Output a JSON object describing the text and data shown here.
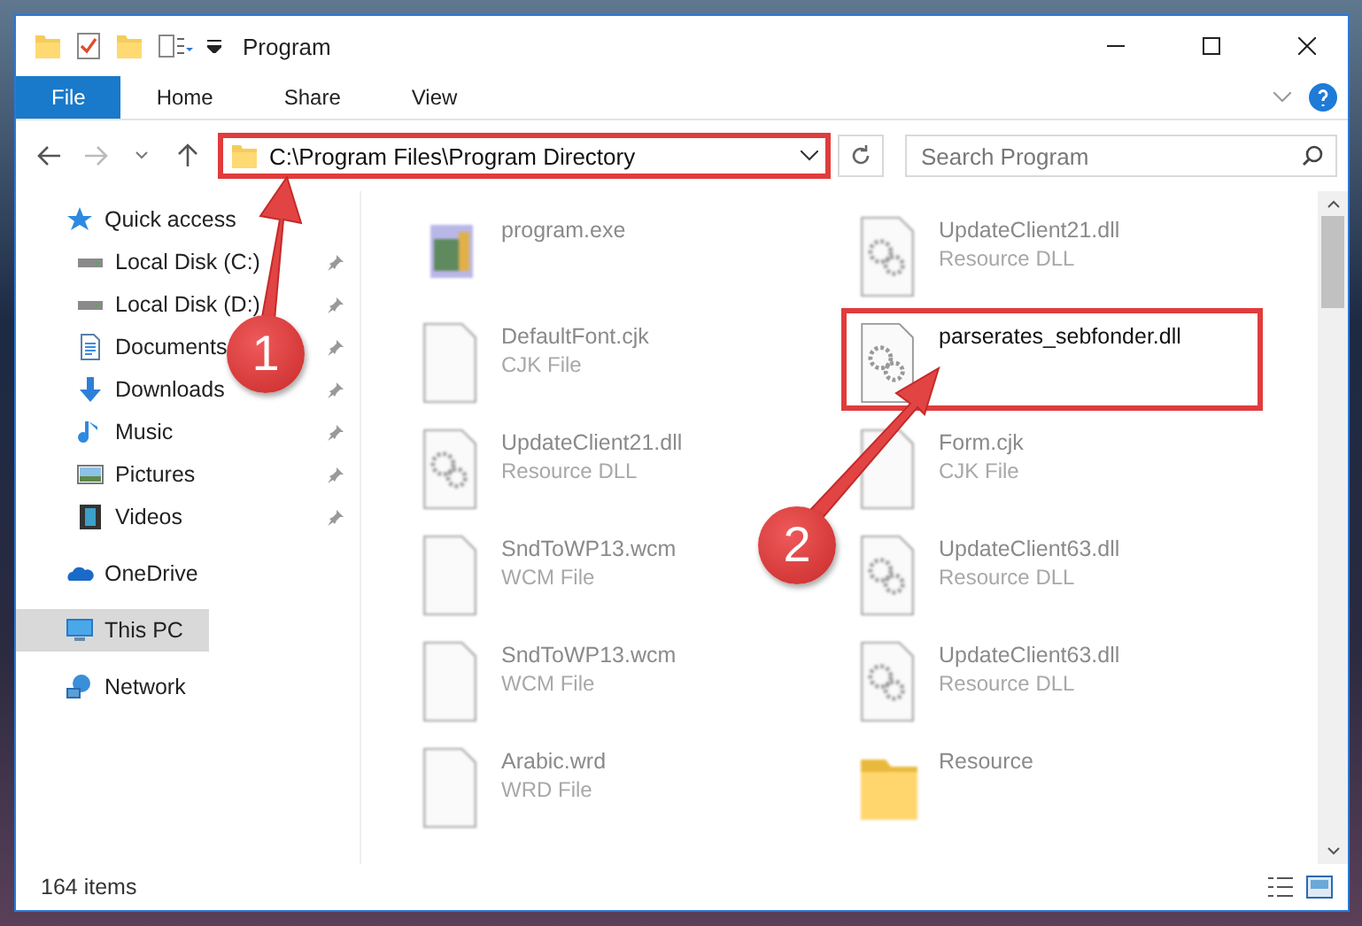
{
  "window": {
    "title": "Program"
  },
  "ribbon_tabs": [
    {
      "label": "File",
      "kind": "menu"
    },
    {
      "label": "Home",
      "kind": "tab"
    },
    {
      "label": "Share",
      "kind": "tab"
    },
    {
      "label": "View",
      "kind": "tab"
    }
  ],
  "address": {
    "path": "C:\\Program Files\\Program Directory"
  },
  "search": {
    "placeholder": "Search Program"
  },
  "sidebar": {
    "items": [
      {
        "label": "Quick access",
        "kind": "star",
        "selected": false,
        "children": [
          {
            "label": "Local Disk (C:)",
            "kind": "disk",
            "pinned": true,
            "selected": false
          },
          {
            "label": "Local Disk (D:)",
            "kind": "disk",
            "pinned": true,
            "selected": false
          },
          {
            "label": "Documents",
            "kind": "document",
            "pinned": true,
            "selected": false
          },
          {
            "label": "Downloads",
            "kind": "download",
            "pinned": true,
            "selected": false
          },
          {
            "label": "Music",
            "kind": "music",
            "pinned": true,
            "selected": false
          },
          {
            "label": "Pictures",
            "kind": "pictures",
            "pinned": true,
            "selected": false
          },
          {
            "label": "Videos",
            "kind": "videos",
            "pinned": true,
            "selected": false
          }
        ]
      },
      {
        "label": "OneDrive",
        "kind": "cloud",
        "selected": false
      },
      {
        "label": "This PC",
        "kind": "pc",
        "selected": true
      },
      {
        "label": "Network",
        "kind": "network",
        "selected": false
      }
    ]
  },
  "files": [
    {
      "name": "program.exe",
      "kind": "exe",
      "marked": false
    },
    {
      "name": "UpdateClient21.dll",
      "type": "Resource DLL",
      "kind": "dll",
      "marked": false
    },
    {
      "name": "DefaultFont.cjk",
      "type": "CJK File",
      "kind": "blank",
      "marked": false
    },
    {
      "name": "parserates_sebfonder.dll",
      "kind": "dll",
      "marked": true
    },
    {
      "name": "UpdateClient21.dll",
      "type": "Resource DLL",
      "kind": "dll",
      "marked": false
    },
    {
      "name": "Form.cjk",
      "type": "CJK File",
      "kind": "blank",
      "marked": false
    },
    {
      "name": "SndToWP13.wcm",
      "type": "WCM File",
      "kind": "blank",
      "marked": false
    },
    {
      "name": "UpdateClient63.dll",
      "type": "Resource DLL",
      "kind": "dll",
      "marked": false
    },
    {
      "name": "SndToWP13.wcm",
      "type": "WCM File",
      "kind": "blank",
      "marked": false
    },
    {
      "name": "UpdateClient63.dll",
      "type": "Resource DLL",
      "kind": "dll",
      "marked": false
    },
    {
      "name": "Arabic.wrd",
      "type": "WRD File",
      "kind": "blank",
      "marked": false
    },
    {
      "name": "Resource",
      "kind": "folder",
      "marked": false
    }
  ],
  "annotations": [
    {
      "number": "1"
    },
    {
      "number": "2"
    }
  ],
  "status_bar": {
    "count": "164 items"
  }
}
